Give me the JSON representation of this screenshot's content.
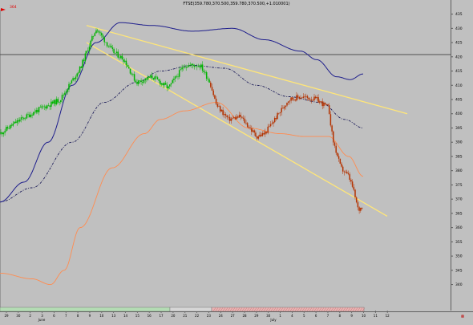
{
  "chart_data": {
    "type": "candlestick",
    "title": "FTSE(359.780,370.500,359.780,370.500,+1.010001)",
    "marker_label": "364",
    "y_ticks": [
      340,
      345,
      350,
      355,
      360,
      365,
      370,
      375,
      380,
      385,
      390,
      395,
      400,
      405,
      410,
      415,
      420,
      425,
      430,
      435
    ],
    "ylim": [
      336.5,
      437.0
    ],
    "x_ticks": [
      "29",
      "30",
      "2",
      "3",
      "6",
      "7",
      "8",
      "9",
      "10",
      "13",
      "14",
      "15",
      "16",
      "17",
      "20",
      "21",
      "22",
      "23",
      "24",
      "27",
      "28",
      "29",
      "30",
      "1",
      "4",
      "5",
      "6",
      "7",
      "8",
      "9",
      "10",
      "11",
      "12"
    ],
    "month_labels": [
      "June",
      "July"
    ],
    "horizontal_line": 420.8,
    "colors": {
      "background": "#c0c0c0",
      "up_candle": "#00b400",
      "down_candle": "#b43200",
      "bollinger": "#1e1e8c",
      "moving_average_long": "#ff8c50",
      "moving_average_mid": "#1e1e5a",
      "trend_channel": "#ffe678",
      "horizontal_line": "#505050",
      "marker": "#e00000"
    },
    "anchors": [
      [
        0,
        393
      ],
      [
        20,
        397
      ],
      [
        45,
        401
      ],
      [
        75,
        405
      ],
      [
        100,
        416
      ],
      [
        120,
        430
      ],
      [
        140,
        422
      ],
      [
        155,
        419
      ],
      [
        170,
        411
      ],
      [
        190,
        413
      ],
      [
        210,
        409
      ],
      [
        230,
        417
      ],
      [
        250,
        417
      ],
      [
        262,
        411
      ],
      [
        270,
        403
      ],
      [
        285,
        398
      ],
      [
        300,
        399
      ],
      [
        320,
        392
      ],
      [
        330,
        393
      ],
      [
        345,
        399
      ],
      [
        360,
        405
      ],
      [
        375,
        406
      ],
      [
        395,
        405
      ],
      [
        410,
        402
      ],
      [
        415,
        391
      ],
      [
        425,
        381
      ],
      [
        435,
        378
      ],
      [
        440,
        374
      ],
      [
        447,
        366
      ],
      [
        453,
        368
      ]
    ],
    "series": [
      {
        "values": [
          [
            0,
            369
          ],
          [
            30,
            376
          ],
          [
            60,
            390
          ],
          [
            90,
            410
          ],
          [
            120,
            425
          ],
          [
            150,
            432
          ],
          [
            190,
            431
          ],
          [
            240,
            429
          ],
          [
            290,
            430
          ],
          [
            330,
            426
          ],
          [
            375,
            422
          ],
          [
            395,
            419
          ],
          [
            420,
            413
          ],
          [
            437,
            412
          ],
          [
            453,
            414
          ]
        ]
      },
      {
        "values": [
          [
            0,
            344
          ],
          [
            40,
            342
          ],
          [
            63,
            340
          ],
          [
            80,
            345
          ],
          [
            100,
            360
          ],
          [
            140,
            381
          ],
          [
            180,
            393
          ],
          [
            200,
            398
          ],
          [
            230,
            401
          ],
          [
            270,
            404
          ],
          [
            310,
            395
          ],
          [
            350,
            393
          ],
          [
            380,
            392
          ],
          [
            410,
            392
          ],
          [
            435,
            385
          ],
          [
            453,
            378
          ]
        ]
      },
      {
        "values": [
          [
            0,
            369
          ],
          [
            40,
            374
          ],
          [
            90,
            390
          ],
          [
            130,
            404
          ],
          [
            170,
            411
          ],
          [
            200,
            415
          ],
          [
            240,
            417
          ],
          [
            280,
            416
          ],
          [
            320,
            410
          ],
          [
            360,
            406
          ],
          [
            400,
            404
          ],
          [
            430,
            398
          ],
          [
            453,
            395
          ]
        ]
      },
      {
        "values": [
          [
            108,
            431
          ],
          [
            508,
            400
          ]
        ]
      },
      {
        "values": [
          [
            108,
            425
          ],
          [
            483,
            364
          ]
        ]
      }
    ]
  }
}
